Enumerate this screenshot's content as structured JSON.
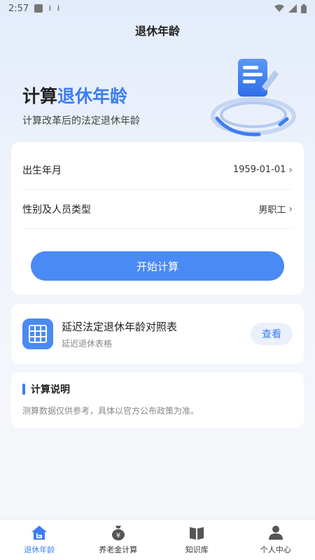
{
  "status_bar": {
    "time": "2:57"
  },
  "header": {
    "title": "退休年龄"
  },
  "hero": {
    "title_prefix": "计算",
    "title_accent": "退休年龄",
    "subtitle": "计算改革后的法定退休年龄"
  },
  "form": {
    "birth_label": "出生年月",
    "birth_value": "1959-01-01",
    "type_label": "性别及人员类型",
    "type_value": "男职工",
    "start_button": "开始计算"
  },
  "delay_table": {
    "title": "延迟法定退休年龄对照表",
    "subtitle": "延迟退休表格",
    "view_button": "查看"
  },
  "note": {
    "title": "计算说明",
    "text": "测算数据仅供参考，具体以官方公布政策为准。"
  },
  "tabs": [
    {
      "label": "退休年龄",
      "icon": "house-icon"
    },
    {
      "label": "养老金计算",
      "icon": "money-bag-icon"
    },
    {
      "label": "知识库",
      "icon": "book-icon"
    },
    {
      "label": "个人中心",
      "icon": "person-icon"
    }
  ],
  "colors": {
    "accent": "#3d7df3",
    "button": "#4a8af4"
  }
}
